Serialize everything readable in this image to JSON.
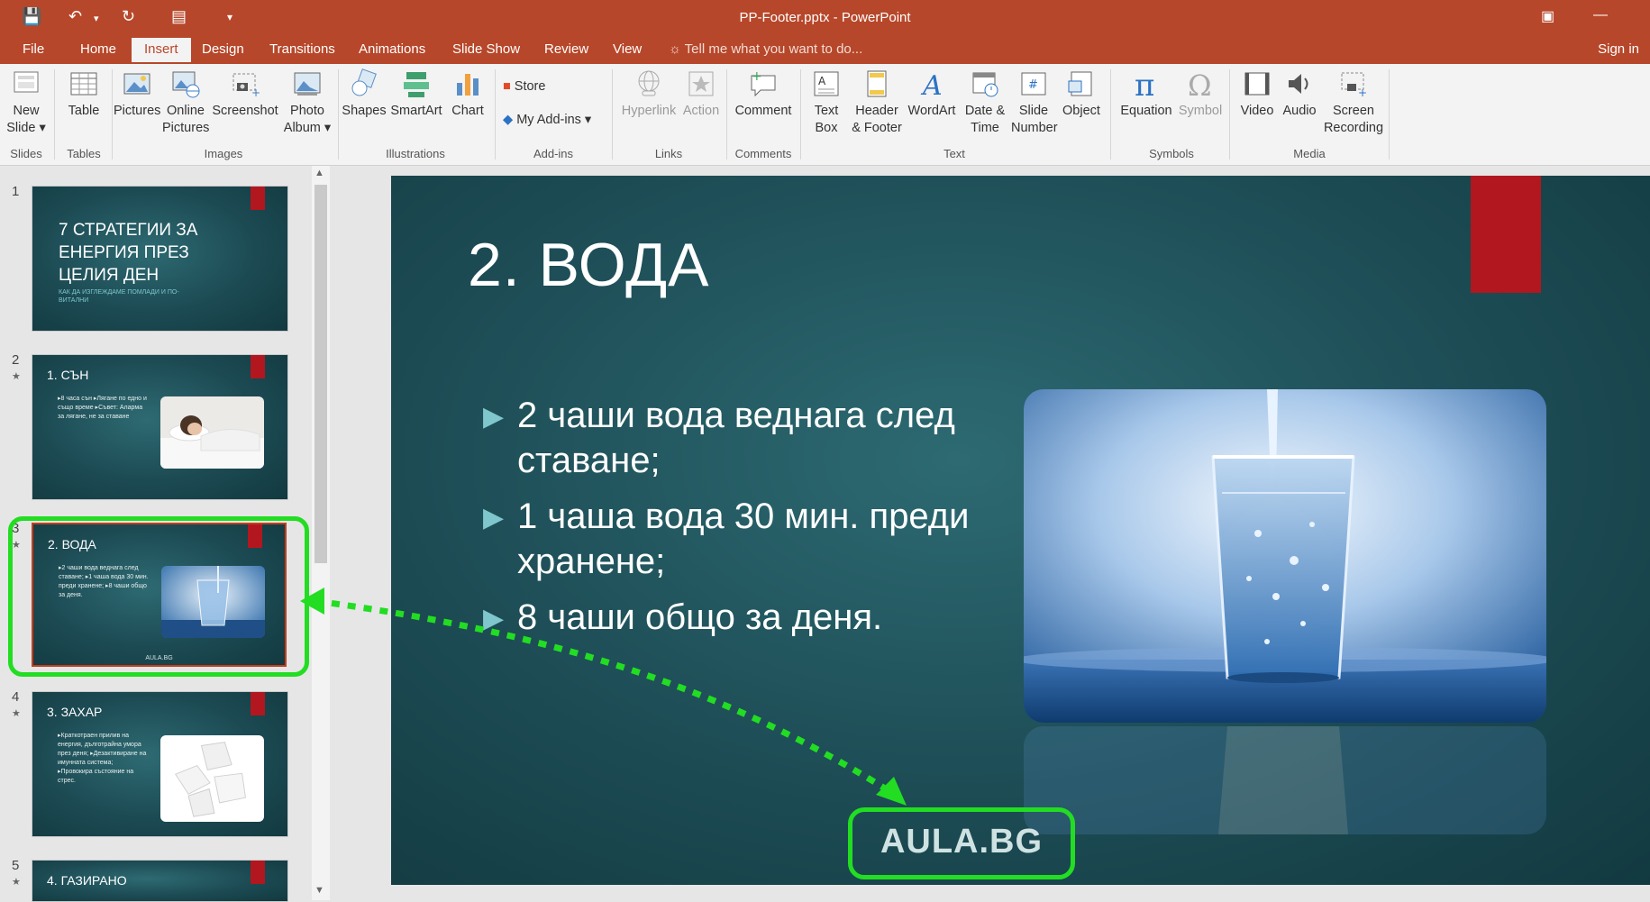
{
  "window": {
    "title": "PP-Footer.pptx - PowerPoint",
    "qat_icons": [
      "save-icon",
      "undo-icon",
      "redo-icon",
      "presentation-icon",
      "customize-icon"
    ]
  },
  "tabs": [
    {
      "label": "File"
    },
    {
      "label": "Home"
    },
    {
      "label": "Insert",
      "active": true
    },
    {
      "label": "Design"
    },
    {
      "label": "Transitions"
    },
    {
      "label": "Animations"
    },
    {
      "label": "Slide Show"
    },
    {
      "label": "Review"
    },
    {
      "label": "View"
    }
  ],
  "tell_me": "Tell me what you want to do...",
  "sign_in": "Sign in",
  "ribbon": {
    "new_slide": "New Slide ▾",
    "table": "Table",
    "pictures": "Pictures",
    "online_pictures": "Online Pictures",
    "screenshot": "Screenshot",
    "photo_album": "Photo Album ▾",
    "shapes": "Shapes",
    "smartart": "SmartArt",
    "chart": "Chart",
    "store": "Store",
    "my_addins": "My Add-ins ▾",
    "hyperlink": "Hyperlink",
    "action": "Action",
    "comment": "Comment",
    "text_box": "Text Box",
    "header_footer": "Header & Footer",
    "wordart": "WordArt",
    "date_time": "Date & Time",
    "slide_number": "Slide Number",
    "object": "Object",
    "equation": "Equation",
    "symbol": "Symbol",
    "video": "Video",
    "audio": "Audio",
    "screen_recording": "Screen Recording",
    "groups": {
      "slides": "Slides",
      "tables": "Tables",
      "images": "Images",
      "illustrations": "Illustrations",
      "addins": "Add-ins",
      "links": "Links",
      "comments": "Comments",
      "text": "Text",
      "symbols": "Symbols",
      "media": "Media"
    }
  },
  "thumbnails": [
    {
      "num": "1",
      "title": "7 СТРАТЕГИИ ЗА ЕНЕРГИЯ ПРЕЗ ЦЕЛИЯ ДЕН",
      "subtitle": "КАК ДА ИЗГЛЕЖДАМЕ ПОМЛАДИ И ПО-ВИТАЛНИ"
    },
    {
      "num": "2",
      "title": "1. СЪН",
      "bullets": "▸8 часа сън ▸Лягане по едно и също време ▸Съвет: Аларма за лягане, не за ставане"
    },
    {
      "num": "3",
      "title": "2. ВОДА",
      "bullets": "▸2 чаши вода веднага след ставане; ▸1 чаша вода 30 мин. преди хранене; ▸8 чаши общо за деня.",
      "footer": "AULA.BG"
    },
    {
      "num": "4",
      "title": "3. ЗАХАР",
      "bullets": "▸Краткотраен прилив на енергия, дълготрайна умора през деня; ▸Дезактивиране на имунната система; ▸Провокира състояние на стрес."
    },
    {
      "num": "5",
      "title": "4. ГАЗИРАНО"
    }
  ],
  "slide": {
    "title": "2. ВОДА",
    "bullets": [
      "2 чаши вода веднага след ставане;",
      "1 чаша вода 30 мин. преди хранене;",
      "8 чаши общо за деня."
    ],
    "footer": "AULA.BG"
  },
  "colors": {
    "accent": "#b7472a",
    "slide_red": "#b2171f",
    "highlight_green": "#22dd22"
  }
}
